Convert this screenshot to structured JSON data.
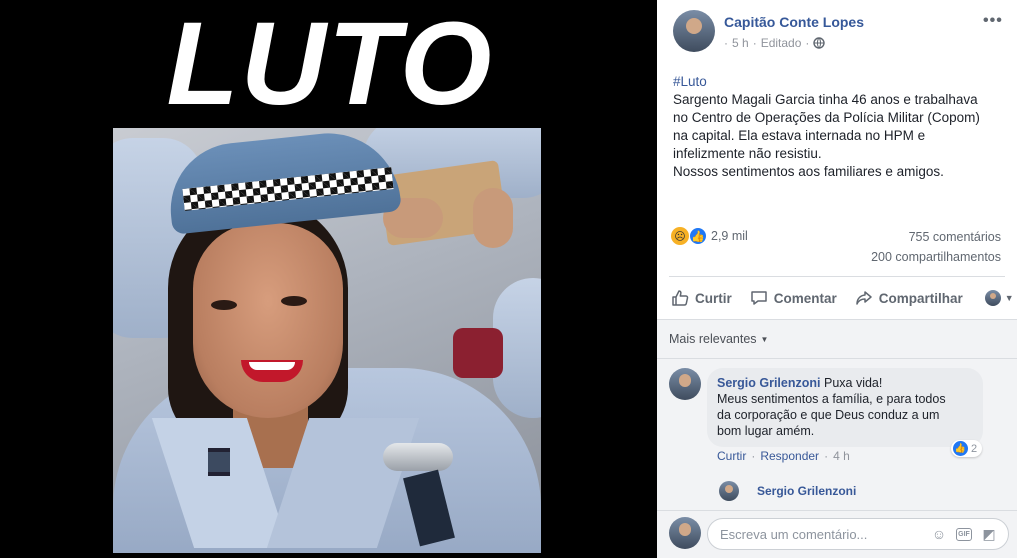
{
  "image_overlay": {
    "headline": "LUTO"
  },
  "post": {
    "author": "Capitão Conte Lopes",
    "time": "5 h",
    "edited": "Editado",
    "hashtag": "#Luto",
    "lines": [
      "Sargento Magali Garcia tinha 46 anos e trabalhava",
      "no Centro de Operações da Polícia Militar (Copom)",
      "na capital. Ela estava internada no HPM e",
      "infelizmente não resistiu.",
      "Nossos sentimentos aos familiares e amigos."
    ],
    "reaction_count": "2,9 mil",
    "comment_count": "755 comentários",
    "share_count": "200 compartilhamentos",
    "reaction_icons": [
      "sad-icon",
      "like-icon"
    ]
  },
  "actions": {
    "like": "Curtir",
    "comment": "Comentar",
    "share": "Compartilhar"
  },
  "comments": {
    "sort_label": "Mais relevantes",
    "items": [
      {
        "author": "Sergio Grilenzoni",
        "first_line": "Puxa vida!",
        "lines": [
          "Meus sentimentos a família, e para todos",
          "da corporação e que Deus conduz a um",
          "bom lugar amém."
        ],
        "likes": "2",
        "like_label": "Curtir",
        "reply_label": "Responder",
        "time": "4 h"
      }
    ],
    "reply_author": "Sergio Grilenzoni",
    "composer_placeholder": "Escreva um comentário..."
  },
  "colors": {
    "link": "#385898",
    "facebook_blue": "#2078f4",
    "meta_gray": "#90949c"
  }
}
